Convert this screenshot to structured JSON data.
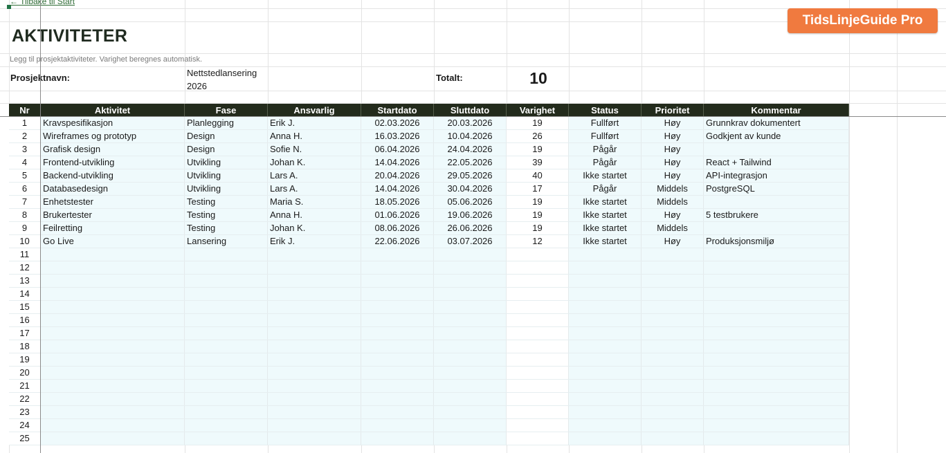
{
  "nav": {
    "back_label": "← Tilbake til Start"
  },
  "brand": {
    "label": "TidsLinjeGuide Pro",
    "color": "#f07a3f"
  },
  "page": {
    "title": "AKTIVITETER",
    "subtitle": "Legg til prosjektaktiviteter. Varighet beregnes automatisk."
  },
  "project": {
    "name_label": "Prosjektnavn:",
    "name_value": "Nettstedlansering 2026",
    "total_label": "Totalt:",
    "total_value": "10"
  },
  "table": {
    "header_color": "#232b1c",
    "tint_color": "#effafc",
    "columns": [
      "Nr",
      "Aktivitet",
      "Fase",
      "Ansvarlig",
      "Startdato",
      "Sluttdato",
      "Varighet",
      "Status",
      "Prioritet",
      "Kommentar"
    ],
    "rows": [
      {
        "nr": "1",
        "aktivitet": "Kravspesifikasjon",
        "fase": "Planlegging",
        "ansvarlig": "Erik J.",
        "start": "02.03.2026",
        "slutt": "20.03.2026",
        "varighet": "19",
        "status": "Fullført",
        "prioritet": "Høy",
        "kommentar": "Grunnkrav dokumentert"
      },
      {
        "nr": "2",
        "aktivitet": "Wireframes og prototyp",
        "fase": "Design",
        "ansvarlig": "Anna H.",
        "start": "16.03.2026",
        "slutt": "10.04.2026",
        "varighet": "26",
        "status": "Fullført",
        "prioritet": "Høy",
        "kommentar": "Godkjent av kunde"
      },
      {
        "nr": "3",
        "aktivitet": "Grafisk design",
        "fase": "Design",
        "ansvarlig": "Sofie N.",
        "start": "06.04.2026",
        "slutt": "24.04.2026",
        "varighet": "19",
        "status": "Pågår",
        "prioritet": "Høy",
        "kommentar": ""
      },
      {
        "nr": "4",
        "aktivitet": "Frontend-utvikling",
        "fase": "Utvikling",
        "ansvarlig": "Johan K.",
        "start": "14.04.2026",
        "slutt": "22.05.2026",
        "varighet": "39",
        "status": "Pågår",
        "prioritet": "Høy",
        "kommentar": "React + Tailwind"
      },
      {
        "nr": "5",
        "aktivitet": "Backend-utvikling",
        "fase": "Utvikling",
        "ansvarlig": "Lars A.",
        "start": "20.04.2026",
        "slutt": "29.05.2026",
        "varighet": "40",
        "status": "Ikke startet",
        "prioritet": "Høy",
        "kommentar": "API-integrasjon"
      },
      {
        "nr": "6",
        "aktivitet": "Databasedesign",
        "fase": "Utvikling",
        "ansvarlig": "Lars A.",
        "start": "14.04.2026",
        "slutt": "30.04.2026",
        "varighet": "17",
        "status": "Pågår",
        "prioritet": "Middels",
        "kommentar": "PostgreSQL"
      },
      {
        "nr": "7",
        "aktivitet": "Enhetstester",
        "fase": "Testing",
        "ansvarlig": "Maria S.",
        "start": "18.05.2026",
        "slutt": "05.06.2026",
        "varighet": "19",
        "status": "Ikke startet",
        "prioritet": "Middels",
        "kommentar": ""
      },
      {
        "nr": "8",
        "aktivitet": "Brukertester",
        "fase": "Testing",
        "ansvarlig": "Anna H.",
        "start": "01.06.2026",
        "slutt": "19.06.2026",
        "varighet": "19",
        "status": "Ikke startet",
        "prioritet": "Høy",
        "kommentar": "5 testbrukere"
      },
      {
        "nr": "9",
        "aktivitet": "Feilretting",
        "fase": "Testing",
        "ansvarlig": "Johan K.",
        "start": "08.06.2026",
        "slutt": "26.06.2026",
        "varighet": "19",
        "status": "Ikke startet",
        "prioritet": "Middels",
        "kommentar": ""
      },
      {
        "nr": "10",
        "aktivitet": "Go Live",
        "fase": "Lansering",
        "ansvarlig": "Erik J.",
        "start": "22.06.2026",
        "slutt": "03.07.2026",
        "varighet": "12",
        "status": "Ikke startet",
        "prioritet": "Høy",
        "kommentar": "Produksjonsmiljø"
      },
      {
        "nr": "11",
        "aktivitet": "",
        "fase": "",
        "ansvarlig": "",
        "start": "",
        "slutt": "",
        "varighet": "",
        "status": "",
        "prioritet": "",
        "kommentar": ""
      },
      {
        "nr": "12",
        "aktivitet": "",
        "fase": "",
        "ansvarlig": "",
        "start": "",
        "slutt": "",
        "varighet": "",
        "status": "",
        "prioritet": "",
        "kommentar": ""
      },
      {
        "nr": "13",
        "aktivitet": "",
        "fase": "",
        "ansvarlig": "",
        "start": "",
        "slutt": "",
        "varighet": "",
        "status": "",
        "prioritet": "",
        "kommentar": ""
      },
      {
        "nr": "14",
        "aktivitet": "",
        "fase": "",
        "ansvarlig": "",
        "start": "",
        "slutt": "",
        "varighet": "",
        "status": "",
        "prioritet": "",
        "kommentar": ""
      },
      {
        "nr": "15",
        "aktivitet": "",
        "fase": "",
        "ansvarlig": "",
        "start": "",
        "slutt": "",
        "varighet": "",
        "status": "",
        "prioritet": "",
        "kommentar": ""
      },
      {
        "nr": "16",
        "aktivitet": "",
        "fase": "",
        "ansvarlig": "",
        "start": "",
        "slutt": "",
        "varighet": "",
        "status": "",
        "prioritet": "",
        "kommentar": ""
      },
      {
        "nr": "17",
        "aktivitet": "",
        "fase": "",
        "ansvarlig": "",
        "start": "",
        "slutt": "",
        "varighet": "",
        "status": "",
        "prioritet": "",
        "kommentar": ""
      },
      {
        "nr": "18",
        "aktivitet": "",
        "fase": "",
        "ansvarlig": "",
        "start": "",
        "slutt": "",
        "varighet": "",
        "status": "",
        "prioritet": "",
        "kommentar": ""
      },
      {
        "nr": "19",
        "aktivitet": "",
        "fase": "",
        "ansvarlig": "",
        "start": "",
        "slutt": "",
        "varighet": "",
        "status": "",
        "prioritet": "",
        "kommentar": ""
      },
      {
        "nr": "20",
        "aktivitet": "",
        "fase": "",
        "ansvarlig": "",
        "start": "",
        "slutt": "",
        "varighet": "",
        "status": "",
        "prioritet": "",
        "kommentar": ""
      },
      {
        "nr": "21",
        "aktivitet": "",
        "fase": "",
        "ansvarlig": "",
        "start": "",
        "slutt": "",
        "varighet": "",
        "status": "",
        "prioritet": "",
        "kommentar": ""
      },
      {
        "nr": "22",
        "aktivitet": "",
        "fase": "",
        "ansvarlig": "",
        "start": "",
        "slutt": "",
        "varighet": "",
        "status": "",
        "prioritet": "",
        "kommentar": ""
      },
      {
        "nr": "23",
        "aktivitet": "",
        "fase": "",
        "ansvarlig": "",
        "start": "",
        "slutt": "",
        "varighet": "",
        "status": "",
        "prioritet": "",
        "kommentar": ""
      },
      {
        "nr": "24",
        "aktivitet": "",
        "fase": "",
        "ansvarlig": "",
        "start": "",
        "slutt": "",
        "varighet": "",
        "status": "",
        "prioritet": "",
        "kommentar": ""
      },
      {
        "nr": "25",
        "aktivitet": "",
        "fase": "",
        "ansvarlig": "",
        "start": "",
        "slutt": "",
        "varighet": "",
        "status": "",
        "prioritet": "",
        "kommentar": ""
      }
    ]
  }
}
